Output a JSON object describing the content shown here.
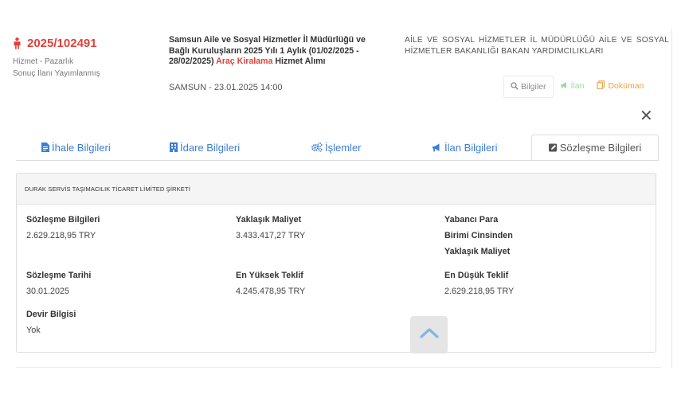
{
  "header": {
    "tender_id": "2025/102491",
    "tender_type": "Hizmet - Pazarlık",
    "tender_status": "Sonuç İlanı Yayımlanmış",
    "title_part1": "Samsun Aile ve Sosyal Hizmetler İl Müdürlüğü ve Bağlı Kuruluşların 2025 Yılı 1 Aylık (01/02/2025 - 28/02/2025) ",
    "title_highlight": "Araç Kiralama",
    "title_part2": " Hizmet Alımı",
    "city_date": "SAMSUN - 23.01.2025 14:00",
    "agency": "AİLE VE SOSYAL HİZMETLER İL MÜDÜRLÜĞÜ AİLE VE SOSYAL HİZMETLER BAKANLIĞI BAKAN YARDIMCILIKLARI",
    "actions": {
      "bilgiler": "Bilgiler",
      "ilan": "İlan",
      "dokuman": "Doküman"
    },
    "close_symbol": "✕"
  },
  "tabs": [
    {
      "label": "İhale Bilgileri"
    },
    {
      "label": "İdare Bilgileri"
    },
    {
      "label": "İşlemler"
    },
    {
      "label": "İlan Bilgileri"
    },
    {
      "label": "Sözleşme Bilgileri",
      "active": true
    }
  ],
  "contract": {
    "company": "DURAK SERVİS TAŞIMACILIK TİCARET LİMİTED ŞİRKETİ",
    "fields": {
      "sozlesme_bilgileri": {
        "label": "Sözleşme Bilgileri",
        "value": "2.629.218,95 TRY"
      },
      "yaklasik_maliyet": {
        "label": "Yaklaşık Maliyet",
        "value": "3.433.417,27 TRY"
      },
      "yabanci_para": {
        "label_line1": "Yabancı Para",
        "label_line2": "Birimi Cinsinden",
        "label_line3": "Yaklaşık Maliyet",
        "value": ""
      },
      "sozlesme_tarihi": {
        "label": "Sözleşme Tarihi",
        "value": "30.01.2025"
      },
      "en_yuksek_teklif": {
        "label": "En Yüksek Teklif",
        "value": "4.245.478,95 TRY"
      },
      "en_dusuk_teklif": {
        "label": "En Düşük Teklif",
        "value": "2.629.218,95 TRY"
      },
      "devir_bilgisi": {
        "label": "Devir Bilgisi",
        "value": "Yok"
      }
    }
  },
  "colors": {
    "accent_red": "#e2403a",
    "tab_blue": "#3b7dd8",
    "ilan_green": "#9fd79f",
    "dokuman_orange": "#e7a33e"
  },
  "icons": {
    "tender": "person-icon",
    "bilgiler": "search-icon",
    "ilan": "megaphone-icon",
    "dokuman": "documents-icon",
    "tab_ihale": "document-icon",
    "tab_idare": "building-icon",
    "tab_islemler": "gears-icon",
    "tab_ilan": "megaphone-icon",
    "tab_sozlesme": "edit-icon",
    "scroll": "chevron-up-icon"
  }
}
